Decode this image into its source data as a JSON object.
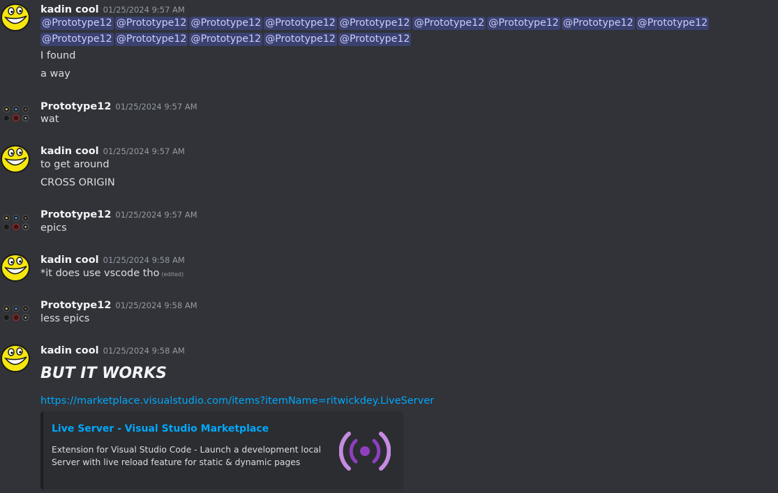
{
  "colors": {
    "background": "#313338",
    "mention_bg": "#3c4270",
    "link": "#00a8fc",
    "embed_bg": "#2b2d31",
    "live_server_purple": "#8e3fbf"
  },
  "messages": [
    {
      "author": "kadin cool",
      "time": "01/25/2024 9:57 AM",
      "mentions": [
        "@Prototype12",
        "@Prototype12",
        "@Prototype12",
        "@Prototype12",
        "@Prototype12",
        "@Prototype12",
        "@Prototype12",
        "@Prototype12",
        "@Prototype12",
        "@Prototype12",
        "@Prototype12",
        "@Prototype12",
        "@Prototype12",
        "@Prototype12"
      ],
      "lines": [
        "I found",
        "a way"
      ]
    },
    {
      "author": "Prototype12",
      "time": "01/25/2024 9:57 AM",
      "lines": [
        "wat"
      ]
    },
    {
      "author": "kadin cool",
      "time": "01/25/2024 9:57 AM",
      "lines": [
        "to get around",
        "CROSS ORIGIN"
      ]
    },
    {
      "author": "Prototype12",
      "time": "01/25/2024 9:57 AM",
      "lines": [
        "epics"
      ]
    },
    {
      "author": "kadin cool",
      "time": "01/25/2024 9:58 AM",
      "lines": [
        "*it does use vscode tho"
      ],
      "edited": "(edited)"
    },
    {
      "author": "Prototype12",
      "time": "01/25/2024 9:58 AM",
      "lines": [
        "less epics"
      ]
    },
    {
      "author": "kadin cool",
      "time": "01/25/2024 9:58 AM",
      "lines": [
        "BUT IT WORKS"
      ],
      "link": "https://marketplace.visualstudio.com/items?itemName=ritwickdey.LiveServer"
    }
  ],
  "embed": {
    "title": "Live Server - Visual Studio Marketplace",
    "description": "Extension for Visual Studio Code - Launch a development local Server with live reload feature for static & dynamic pages",
    "thumbnail_icon": "broadcast-icon"
  }
}
